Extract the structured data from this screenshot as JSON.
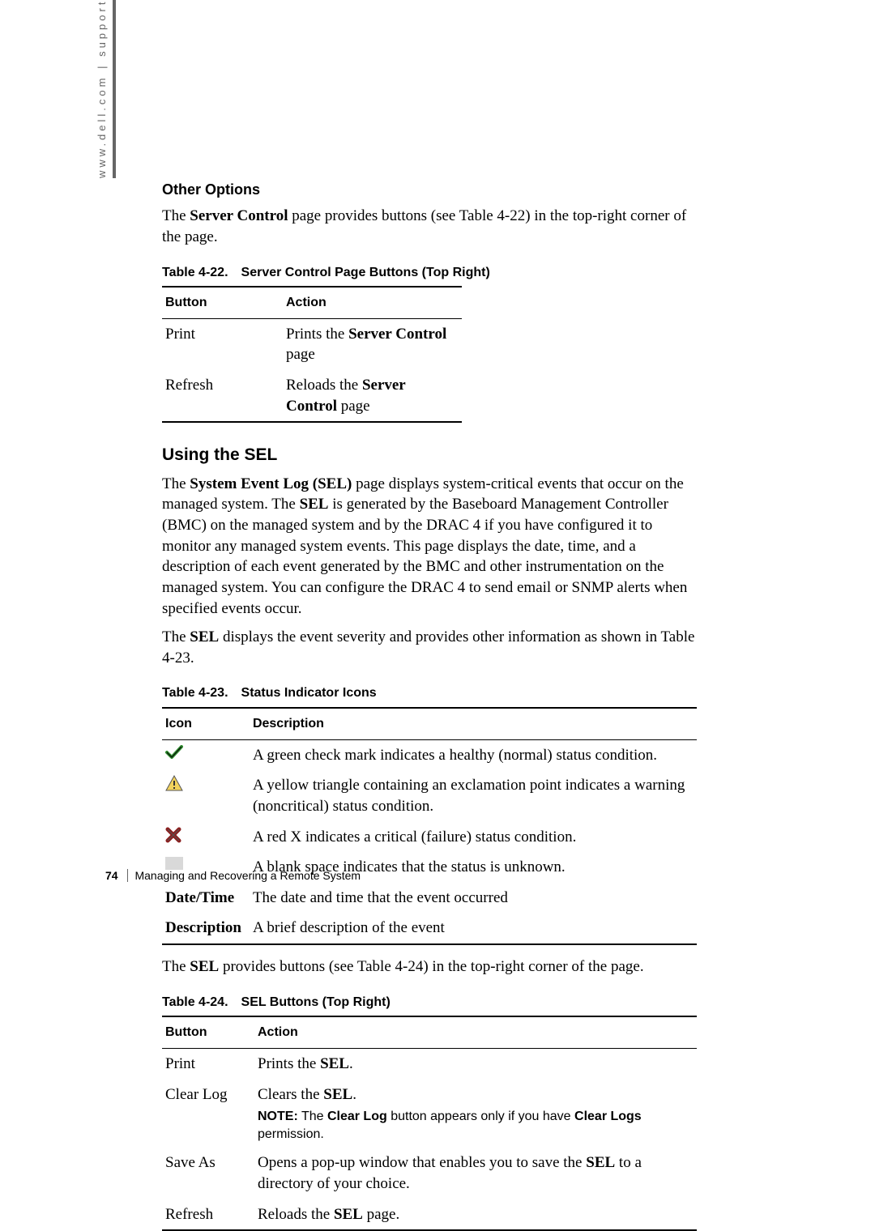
{
  "side_tab": "www.dell.com | support.dell.com",
  "h_other_options": "Other Options",
  "p_server_control_intro_1": "The ",
  "p_server_control_intro_bold": "Server Control",
  "p_server_control_intro_2": " page provides buttons (see Table 4-22) in the top-right corner of the page.",
  "table22": {
    "caption_num": "Table 4-22.",
    "caption_title": "Server Control Page Buttons (Top Right)",
    "headers": {
      "button": "Button",
      "action": "Action"
    },
    "rows": [
      {
        "button": "Print",
        "action_1": "Prints the ",
        "action_bold": "Server Control",
        "action_2": " page"
      },
      {
        "button": "Refresh",
        "action_1": "Reloads the ",
        "action_bold": "Server Control",
        "action_2": " page"
      }
    ]
  },
  "h_using_sel": "Using the SEL",
  "sel_para1_parts": {
    "a": "The ",
    "b": "System Event Log (SEL)",
    "c": " page displays system-critical events that occur on the managed system. The ",
    "d": "SEL",
    "e": " is generated by the Baseboard Management Controller (BMC) on the managed system and by the DRAC 4 if you have configured it to monitor any managed system events. This page displays the date, time, and a description of each event generated by the BMC and other instrumentation on the managed system. You can configure the DRAC 4 to send email or SNMP alerts when specified events occur."
  },
  "sel_para2_parts": {
    "a": "The ",
    "b": "SEL",
    "c": " displays the event severity and provides other information as shown in Table 4-23."
  },
  "table23": {
    "caption_num": "Table 4-23.",
    "caption_title": "Status Indicator Icons",
    "headers": {
      "icon": "Icon",
      "description": "Description"
    },
    "rows": [
      {
        "icon_kind": "check",
        "label": "",
        "description": "A green check mark indicates a healthy (normal) status condition."
      },
      {
        "icon_kind": "warn",
        "label": "",
        "description": "A yellow triangle containing an exclamation point indicates a warning (noncritical) status condition."
      },
      {
        "icon_kind": "fail",
        "label": "",
        "description": "A red X indicates a critical (failure) status condition."
      },
      {
        "icon_kind": "blank",
        "label": "",
        "description": "A blank space indicates that the status is unknown."
      },
      {
        "icon_kind": "text",
        "label": "Date/Time",
        "description": "The date and time that the event occurred"
      },
      {
        "icon_kind": "text",
        "label": "Description",
        "description": "A brief description of the event"
      }
    ]
  },
  "sel_para3_parts": {
    "a": "The ",
    "b": "SEL",
    "c": " provides buttons (see Table 4-24) in the top-right corner of the page."
  },
  "table24": {
    "caption_num": "Table 4-24.",
    "caption_title": "SEL Buttons (Top Right)",
    "headers": {
      "button": "Button",
      "action": "Action"
    },
    "rows": [
      {
        "button": "Print",
        "action_pre": "Prints the ",
        "action_bold": "SEL",
        "action_post": ".",
        "note": null
      },
      {
        "button": "Clear Log",
        "action_pre": "Clears the ",
        "action_bold": "SEL",
        "action_post": ".",
        "note_lead": "NOTE:",
        "note_a": " The ",
        "note_b": "Clear Log",
        "note_c": " button appears only if you have ",
        "note_d": "Clear Logs",
        "note_e": " permission."
      },
      {
        "button": "Save As",
        "action_pre": "Opens a pop-up window that enables you to save the ",
        "action_bold": "SEL",
        "action_post": " to a directory of your choice.",
        "note": null
      },
      {
        "button": "Refresh",
        "action_pre": "Reloads the ",
        "action_bold": "SEL",
        "action_post": " page.",
        "note": null
      }
    ]
  },
  "footer": {
    "page_number": "74",
    "chapter": "Managing and Recovering a Remote System"
  }
}
